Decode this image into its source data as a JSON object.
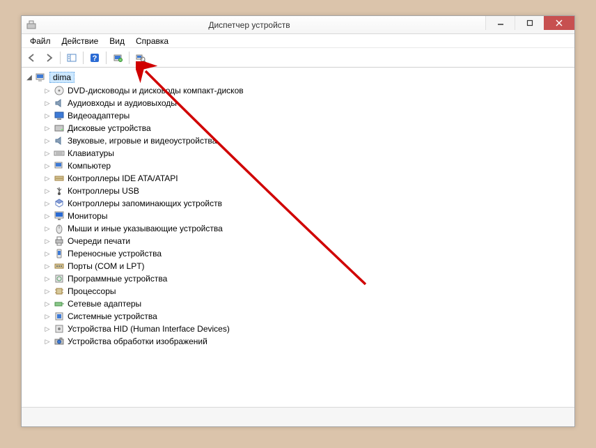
{
  "window": {
    "title": "Диспетчер устройств"
  },
  "menu": {
    "file": "Файл",
    "action": "Действие",
    "view": "Вид",
    "help": "Справка"
  },
  "tree": {
    "root": "dima",
    "nodes": [
      {
        "label": "DVD-дисководы и дисководы компакт-дисков",
        "icon": "disc"
      },
      {
        "label": "Аудиовходы и аудиовыходы",
        "icon": "audio"
      },
      {
        "label": "Видеоадаптеры",
        "icon": "display"
      },
      {
        "label": "Дисковые устройства",
        "icon": "hdd"
      },
      {
        "label": "Звуковые, игровые и видеоустройства",
        "icon": "audio"
      },
      {
        "label": "Клавиатуры",
        "icon": "keyboard"
      },
      {
        "label": "Компьютер",
        "icon": "computer"
      },
      {
        "label": "Контроллеры IDE ATA/ATAPI",
        "icon": "ide"
      },
      {
        "label": "Контроллеры USB",
        "icon": "usb"
      },
      {
        "label": "Контроллеры запоминающих устройств",
        "icon": "storage"
      },
      {
        "label": "Мониторы",
        "icon": "monitor"
      },
      {
        "label": "Мыши и иные указывающие устройства",
        "icon": "mouse"
      },
      {
        "label": "Очереди печати",
        "icon": "printer"
      },
      {
        "label": "Переносные устройства",
        "icon": "portable"
      },
      {
        "label": "Порты (COM и LPT)",
        "icon": "port"
      },
      {
        "label": "Программные устройства",
        "icon": "soft"
      },
      {
        "label": "Процессоры",
        "icon": "cpu"
      },
      {
        "label": "Сетевые адаптеры",
        "icon": "net"
      },
      {
        "label": "Системные устройства",
        "icon": "sys"
      },
      {
        "label": "Устройства HID (Human Interface Devices)",
        "icon": "hid"
      },
      {
        "label": "Устройства обработки изображений",
        "icon": "camera"
      }
    ]
  }
}
